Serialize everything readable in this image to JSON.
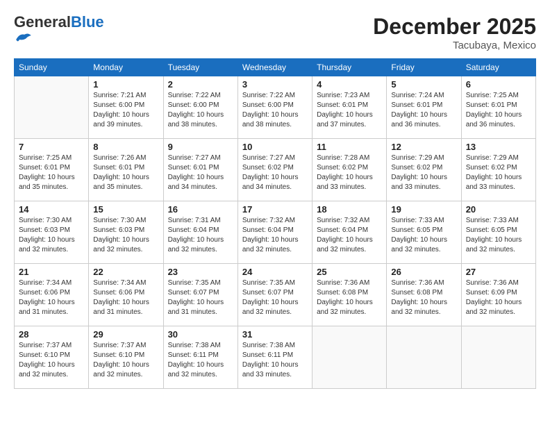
{
  "header": {
    "logo_general": "General",
    "logo_blue": "Blue",
    "month_year": "December 2025",
    "location": "Tacubaya, Mexico"
  },
  "days_of_week": [
    "Sunday",
    "Monday",
    "Tuesday",
    "Wednesday",
    "Thursday",
    "Friday",
    "Saturday"
  ],
  "weeks": [
    [
      {
        "day": "",
        "info": ""
      },
      {
        "day": "1",
        "info": "Sunrise: 7:21 AM\nSunset: 6:00 PM\nDaylight: 10 hours\nand 39 minutes."
      },
      {
        "day": "2",
        "info": "Sunrise: 7:22 AM\nSunset: 6:00 PM\nDaylight: 10 hours\nand 38 minutes."
      },
      {
        "day": "3",
        "info": "Sunrise: 7:22 AM\nSunset: 6:00 PM\nDaylight: 10 hours\nand 38 minutes."
      },
      {
        "day": "4",
        "info": "Sunrise: 7:23 AM\nSunset: 6:01 PM\nDaylight: 10 hours\nand 37 minutes."
      },
      {
        "day": "5",
        "info": "Sunrise: 7:24 AM\nSunset: 6:01 PM\nDaylight: 10 hours\nand 36 minutes."
      },
      {
        "day": "6",
        "info": "Sunrise: 7:25 AM\nSunset: 6:01 PM\nDaylight: 10 hours\nand 36 minutes."
      }
    ],
    [
      {
        "day": "7",
        "info": "Sunrise: 7:25 AM\nSunset: 6:01 PM\nDaylight: 10 hours\nand 35 minutes."
      },
      {
        "day": "8",
        "info": "Sunrise: 7:26 AM\nSunset: 6:01 PM\nDaylight: 10 hours\nand 35 minutes."
      },
      {
        "day": "9",
        "info": "Sunrise: 7:27 AM\nSunset: 6:01 PM\nDaylight: 10 hours\nand 34 minutes."
      },
      {
        "day": "10",
        "info": "Sunrise: 7:27 AM\nSunset: 6:02 PM\nDaylight: 10 hours\nand 34 minutes."
      },
      {
        "day": "11",
        "info": "Sunrise: 7:28 AM\nSunset: 6:02 PM\nDaylight: 10 hours\nand 33 minutes."
      },
      {
        "day": "12",
        "info": "Sunrise: 7:29 AM\nSunset: 6:02 PM\nDaylight: 10 hours\nand 33 minutes."
      },
      {
        "day": "13",
        "info": "Sunrise: 7:29 AM\nSunset: 6:02 PM\nDaylight: 10 hours\nand 33 minutes."
      }
    ],
    [
      {
        "day": "14",
        "info": "Sunrise: 7:30 AM\nSunset: 6:03 PM\nDaylight: 10 hours\nand 32 minutes."
      },
      {
        "day": "15",
        "info": "Sunrise: 7:30 AM\nSunset: 6:03 PM\nDaylight: 10 hours\nand 32 minutes."
      },
      {
        "day": "16",
        "info": "Sunrise: 7:31 AM\nSunset: 6:04 PM\nDaylight: 10 hours\nand 32 minutes."
      },
      {
        "day": "17",
        "info": "Sunrise: 7:32 AM\nSunset: 6:04 PM\nDaylight: 10 hours\nand 32 minutes."
      },
      {
        "day": "18",
        "info": "Sunrise: 7:32 AM\nSunset: 6:04 PM\nDaylight: 10 hours\nand 32 minutes."
      },
      {
        "day": "19",
        "info": "Sunrise: 7:33 AM\nSunset: 6:05 PM\nDaylight: 10 hours\nand 32 minutes."
      },
      {
        "day": "20",
        "info": "Sunrise: 7:33 AM\nSunset: 6:05 PM\nDaylight: 10 hours\nand 32 minutes."
      }
    ],
    [
      {
        "day": "21",
        "info": "Sunrise: 7:34 AM\nSunset: 6:06 PM\nDaylight: 10 hours\nand 31 minutes."
      },
      {
        "day": "22",
        "info": "Sunrise: 7:34 AM\nSunset: 6:06 PM\nDaylight: 10 hours\nand 31 minutes."
      },
      {
        "day": "23",
        "info": "Sunrise: 7:35 AM\nSunset: 6:07 PM\nDaylight: 10 hours\nand 31 minutes."
      },
      {
        "day": "24",
        "info": "Sunrise: 7:35 AM\nSunset: 6:07 PM\nDaylight: 10 hours\nand 32 minutes."
      },
      {
        "day": "25",
        "info": "Sunrise: 7:36 AM\nSunset: 6:08 PM\nDaylight: 10 hours\nand 32 minutes."
      },
      {
        "day": "26",
        "info": "Sunrise: 7:36 AM\nSunset: 6:08 PM\nDaylight: 10 hours\nand 32 minutes."
      },
      {
        "day": "27",
        "info": "Sunrise: 7:36 AM\nSunset: 6:09 PM\nDaylight: 10 hours\nand 32 minutes."
      }
    ],
    [
      {
        "day": "28",
        "info": "Sunrise: 7:37 AM\nSunset: 6:10 PM\nDaylight: 10 hours\nand 32 minutes."
      },
      {
        "day": "29",
        "info": "Sunrise: 7:37 AM\nSunset: 6:10 PM\nDaylight: 10 hours\nand 32 minutes."
      },
      {
        "day": "30",
        "info": "Sunrise: 7:38 AM\nSunset: 6:11 PM\nDaylight: 10 hours\nand 32 minutes."
      },
      {
        "day": "31",
        "info": "Sunrise: 7:38 AM\nSunset: 6:11 PM\nDaylight: 10 hours\nand 33 minutes."
      },
      {
        "day": "",
        "info": ""
      },
      {
        "day": "",
        "info": ""
      },
      {
        "day": "",
        "info": ""
      }
    ]
  ]
}
